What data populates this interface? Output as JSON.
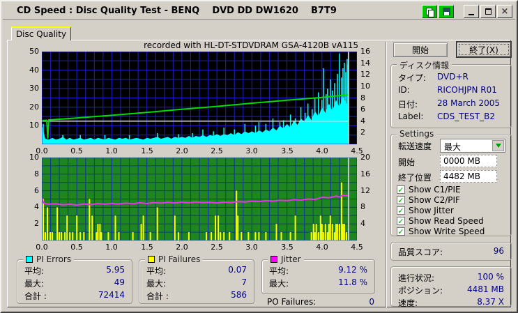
{
  "window": {
    "title": "CD Speed : Disc Quality Test - BENQ    DVD DD DW1620    B7T9",
    "controls": [
      "copy",
      "save",
      "minimize",
      "maximize",
      "close"
    ]
  },
  "tab": {
    "label": "Disc Quality"
  },
  "buttons": {
    "start": "開始",
    "exit": "終了(X)"
  },
  "disc_info": {
    "title": "ディスク情報",
    "rows": [
      {
        "label": "タイプ:",
        "value": "DVD+R"
      },
      {
        "label": "ID:",
        "value": "RICOHJPN R01"
      },
      {
        "label": "日付:",
        "value": "28 March 2005"
      },
      {
        "label": "Label:",
        "value": "CDS_TEST_B2"
      }
    ]
  },
  "settings": {
    "title": "Settings",
    "speed_label": "転送速度",
    "speed_value": "最大",
    "start_label": "開始",
    "start_value": "0000 MB",
    "end_label": "終了位置",
    "end_value": "4482 MB",
    "checkboxes": [
      {
        "label": "Show C1/PIE",
        "checked": true
      },
      {
        "label": "Show C2/PIF",
        "checked": true
      },
      {
        "label": "Show Jitter",
        "checked": true
      },
      {
        "label": "Show Read Speed",
        "checked": true
      },
      {
        "label": "Show Write Speed",
        "checked": true
      }
    ]
  },
  "quality": {
    "label": "品質スコア:",
    "value": "96"
  },
  "progress": {
    "rows": [
      {
        "label": "進行状況:",
        "value": "100 %"
      },
      {
        "label": "ポジション:",
        "value": "4481 MB"
      },
      {
        "label": "速度:",
        "value": "8.37 X"
      }
    ]
  },
  "legends": [
    {
      "name": "PI Errors",
      "swatch": "#00ffff",
      "rows": [
        {
          "label": "平均:",
          "value": "5.95"
        },
        {
          "label": "最大:",
          "value": "49"
        },
        {
          "label": "合計 :",
          "value": "72414"
        }
      ]
    },
    {
      "name": "PI Failures",
      "swatch": "#ffff00",
      "rows": [
        {
          "label": "平均:",
          "value": "0.07"
        },
        {
          "label": "最大:",
          "value": "7"
        },
        {
          "label": "合計 :",
          "value": "586"
        }
      ]
    },
    {
      "name": "Jitter",
      "swatch": "#ff00ff",
      "rows": [
        {
          "label": "平均:",
          "value": "9.12 %"
        },
        {
          "label": "最大:",
          "value": "11.8 %"
        }
      ]
    }
  ],
  "po_failures": {
    "label": "PO Failures:",
    "value": "0"
  },
  "chart_data": {
    "top": {
      "type": "area+spikes+line",
      "title": "recorded with HL-DT-STDVDRAM GSA-4120B vA115",
      "x_unit": "GB",
      "x_range": [
        0,
        4.5
      ],
      "x_ticks": [
        "0.0",
        "0.5",
        "1.0",
        "1.5",
        "2.0",
        "2.5",
        "3.0",
        "3.5",
        "4.0",
        "4.5"
      ],
      "left_axis": {
        "range": [
          0,
          50
        ],
        "ticks": [
          10,
          20,
          30,
          40,
          50
        ]
      },
      "right_axis": {
        "range": [
          0,
          16
        ],
        "ticks": [
          2,
          4,
          6,
          8,
          10,
          12,
          14,
          16
        ]
      },
      "end_of_data_x": 4.38,
      "colors": {
        "bg": "#000000",
        "grid": "#2020c8",
        "pi_errors": "#00ffff",
        "read_speed": "#00dc00",
        "write_speed": "#dcdcdc",
        "end_marker": "#c8c8c8"
      },
      "pi_errors_area_step": 0.05,
      "pi_errors_area": [
        10.5,
        3,
        2.5,
        3.5,
        2.5,
        3,
        4,
        2.5,
        3.5,
        2.5,
        3,
        3.5,
        2.5,
        3,
        3.5,
        2.5,
        3.5,
        3,
        2.5,
        3.5,
        3,
        2.5,
        3.5,
        3,
        3.5,
        2.5,
        3,
        3.5,
        3,
        2.5,
        3.5,
        3,
        3.5,
        4,
        3,
        3.5,
        4,
        3,
        4,
        3.5,
        4,
        3.5,
        4.5,
        3.5,
        4.5,
        4,
        5,
        4,
        5,
        4.5,
        5.5,
        4.5,
        5.5,
        5,
        6,
        5,
        6.5,
        5.5,
        7,
        6,
        7,
        6,
        7.5,
        6.5,
        8,
        7,
        9,
        7.5,
        10,
        8.5,
        11,
        9,
        13,
        10.5,
        14,
        12,
        16,
        13,
        18,
        15,
        20,
        17,
        22,
        18,
        24,
        20,
        26,
        22,
        30
      ],
      "pi_errors_spikes": [
        [
          0.02,
          11
        ],
        [
          0.3,
          5
        ],
        [
          0.55,
          5
        ],
        [
          0.9,
          5
        ],
        [
          1.25,
          5
        ],
        [
          1.65,
          6
        ],
        [
          1.95,
          5.5
        ],
        [
          2.15,
          6
        ],
        [
          2.3,
          8
        ],
        [
          2.45,
          7
        ],
        [
          2.6,
          9
        ],
        [
          2.75,
          8
        ],
        [
          2.9,
          11
        ],
        [
          3.05,
          10
        ],
        [
          3.1,
          12
        ],
        [
          3.2,
          11
        ],
        [
          3.3,
          14
        ],
        [
          3.4,
          12
        ],
        [
          3.45,
          13
        ],
        [
          3.55,
          16
        ],
        [
          3.62,
          14
        ],
        [
          3.7,
          20
        ],
        [
          3.76,
          17
        ],
        [
          3.8,
          22
        ],
        [
          3.86,
          19
        ],
        [
          3.9,
          25
        ],
        [
          3.95,
          28
        ],
        [
          4.0,
          24
        ],
        [
          4.02,
          41
        ],
        [
          4.06,
          27
        ],
        [
          4.08,
          30
        ],
        [
          4.12,
          35
        ],
        [
          4.15,
          29
        ],
        [
          4.18,
          33
        ],
        [
          4.22,
          38
        ],
        [
          4.25,
          49
        ],
        [
          4.28,
          36
        ],
        [
          4.3,
          41
        ],
        [
          4.32,
          44
        ],
        [
          4.34,
          39
        ],
        [
          4.36,
          46
        ],
        [
          4.375,
          43
        ]
      ],
      "read_speed_line": [
        [
          0,
          4.1
        ],
        [
          0.07,
          4.15
        ],
        [
          0.085,
          1.0
        ],
        [
          0.1,
          4.2
        ],
        [
          0.5,
          4.55
        ],
        [
          1.0,
          5.0
        ],
        [
          1.5,
          5.5
        ],
        [
          2.0,
          6.05
        ],
        [
          2.5,
          6.55
        ],
        [
          3.0,
          7.1
        ],
        [
          3.5,
          7.6
        ],
        [
          4.0,
          8.1
        ],
        [
          4.38,
          8.55
        ]
      ],
      "write_speed_line": [
        [
          0,
          4.0
        ],
        [
          4.38,
          4.0
        ]
      ]
    },
    "bottom": {
      "type": "spikes+line",
      "x_unit": "GB",
      "x_range": [
        0,
        4.5
      ],
      "x_ticks": [
        "0.0",
        "0.5",
        "1.0",
        "1.5",
        "2.0",
        "2.5",
        "3.0",
        "3.5",
        "4.0",
        "4.5"
      ],
      "left_axis": {
        "range": [
          0,
          10
        ],
        "ticks": [
          2,
          4,
          6,
          8,
          10
        ]
      },
      "right_axis": {
        "range": [
          0,
          20
        ],
        "ticks": [
          4,
          8,
          12,
          16,
          20
        ]
      },
      "end_of_data_x": 4.38,
      "colors": {
        "bg": "#1e861e",
        "grid": "#1030b0",
        "pi_failures": "#ffff00",
        "jitter": "#ee30ee",
        "end_marker": "#c8c8c8"
      },
      "pi_failures_spikes": [
        [
          0.02,
          5
        ],
        [
          0.05,
          1
        ],
        [
          0.08,
          4
        ],
        [
          0.12,
          1
        ],
        [
          0.15,
          1
        ],
        [
          0.22,
          4
        ],
        [
          0.25,
          1
        ],
        [
          0.28,
          1
        ],
        [
          0.33,
          1
        ],
        [
          0.36,
          3
        ],
        [
          0.4,
          1
        ],
        [
          0.44,
          1
        ],
        [
          0.5,
          3
        ],
        [
          0.55,
          1
        ],
        [
          0.6,
          1
        ],
        [
          0.68,
          5
        ],
        [
          0.72,
          3
        ],
        [
          0.78,
          1
        ],
        [
          0.8,
          2
        ],
        [
          0.83,
          2
        ],
        [
          0.85,
          1
        ],
        [
          0.95,
          1
        ],
        [
          1.05,
          3
        ],
        [
          1.1,
          1
        ],
        [
          1.3,
          1
        ],
        [
          1.42,
          2
        ],
        [
          1.45,
          3
        ],
        [
          1.55,
          1
        ],
        [
          1.65,
          4
        ],
        [
          1.9,
          3
        ],
        [
          1.95,
          1
        ],
        [
          2.1,
          1
        ],
        [
          2.35,
          1
        ],
        [
          2.42,
          1
        ],
        [
          2.48,
          3
        ],
        [
          2.52,
          3
        ],
        [
          2.55,
          1
        ],
        [
          2.6,
          1
        ],
        [
          2.68,
          1
        ],
        [
          2.78,
          6
        ],
        [
          2.8,
          3
        ],
        [
          2.85,
          1
        ],
        [
          2.95,
          1
        ],
        [
          3.05,
          1
        ],
        [
          3.1,
          1
        ],
        [
          3.2,
          1
        ],
        [
          3.35,
          2
        ],
        [
          3.42,
          1
        ],
        [
          3.55,
          1
        ],
        [
          3.62,
          3
        ],
        [
          3.85,
          1
        ],
        [
          3.88,
          2
        ],
        [
          3.9,
          1
        ],
        [
          3.92,
          2
        ],
        [
          3.95,
          1
        ],
        [
          3.98,
          3
        ],
        [
          4.0,
          2
        ],
        [
          4.02,
          1
        ],
        [
          4.05,
          2
        ],
        [
          4.08,
          1
        ],
        [
          4.1,
          2
        ],
        [
          4.12,
          3
        ],
        [
          4.15,
          2
        ],
        [
          4.18,
          1
        ],
        [
          4.2,
          2
        ],
        [
          4.22,
          2
        ],
        [
          4.25,
          2
        ],
        [
          4.28,
          7
        ],
        [
          4.3,
          2
        ],
        [
          4.32,
          2
        ],
        [
          4.35,
          1
        ]
      ],
      "jitter_line": [
        [
          0,
          10.2
        ],
        [
          0.03,
          8.95
        ],
        [
          0.1,
          8.75
        ],
        [
          0.2,
          8.85
        ],
        [
          0.3,
          8.6
        ],
        [
          0.4,
          8.75
        ],
        [
          0.5,
          8.55
        ],
        [
          0.6,
          8.8
        ],
        [
          0.7,
          8.65
        ],
        [
          0.8,
          8.9
        ],
        [
          0.9,
          8.75
        ],
        [
          1.0,
          8.95
        ],
        [
          1.1,
          8.8
        ],
        [
          1.2,
          9.0
        ],
        [
          1.3,
          8.85
        ],
        [
          1.4,
          9.1
        ],
        [
          1.5,
          8.9
        ],
        [
          1.6,
          9.15
        ],
        [
          1.7,
          9.0
        ],
        [
          1.8,
          9.2
        ],
        [
          1.9,
          9.05
        ],
        [
          2.0,
          9.25
        ],
        [
          2.1,
          9.1
        ],
        [
          2.2,
          9.3
        ],
        [
          2.3,
          9.15
        ],
        [
          2.4,
          9.2
        ],
        [
          2.5,
          9.05
        ],
        [
          2.6,
          9.25
        ],
        [
          2.7,
          9.15
        ],
        [
          2.8,
          9.4
        ],
        [
          2.9,
          9.3
        ],
        [
          3.0,
          9.5
        ],
        [
          3.1,
          9.4
        ],
        [
          3.2,
          9.6
        ],
        [
          3.3,
          9.5
        ],
        [
          3.4,
          9.7
        ],
        [
          3.5,
          9.6
        ],
        [
          3.6,
          9.85
        ],
        [
          3.7,
          9.75
        ],
        [
          3.8,
          10.0
        ],
        [
          3.9,
          9.9
        ],
        [
          4.0,
          10.4
        ],
        [
          4.1,
          10.3
        ],
        [
          4.2,
          10.7
        ],
        [
          4.25,
          10.5
        ],
        [
          4.3,
          10.9
        ],
        [
          4.35,
          10.8
        ],
        [
          4.38,
          10.9
        ]
      ]
    }
  }
}
